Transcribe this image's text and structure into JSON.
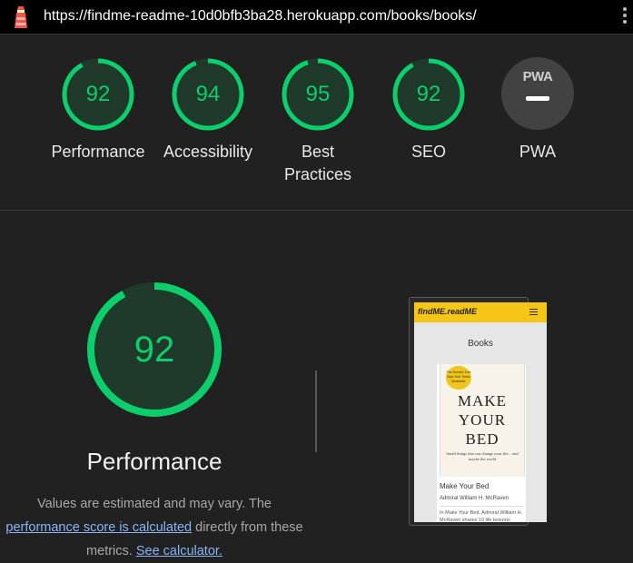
{
  "topbar": {
    "logo_icon": "lighthouse-icon",
    "url": "https://findme-readme-10d0bfb3ba28.herokuapp.com/books/books/",
    "menu_icon": "kebab-menu-icon"
  },
  "colors": {
    "pass": "#0cce6b",
    "pwa_gray": "#424242",
    "background": "#212121"
  },
  "summary": {
    "categories": [
      {
        "label": "Performance",
        "score": "92",
        "value": 92
      },
      {
        "label": "Accessibility",
        "score": "94",
        "value": 94
      },
      {
        "label": "Best Practices",
        "score": "95",
        "value": 95
      },
      {
        "label": "SEO",
        "score": "92",
        "value": 92
      }
    ],
    "pwa": {
      "label": "PWA",
      "badge": "PWA"
    }
  },
  "performance": {
    "score": "92",
    "value": 92,
    "title": "Performance",
    "desc_prefix": "Values are estimated and may vary. The",
    "desc_link1": "performance score is calculated",
    "desc_mid": "directly from these",
    "desc_metrics": "metrics.",
    "desc_link2": "See calculator."
  },
  "screenshot": {
    "brand": "findME.readME",
    "heading": "Books",
    "book_title": "Make Your Bed",
    "author": "Admiral William H. McRaven",
    "desc_snippet": "In Make Your Bed, Admiral William H. McRaven shares 10 life lessons",
    "cover_title_line1": "MAKE",
    "cover_title_line2": "YOUR",
    "cover_title_line3": "BED",
    "cover_subtitle": "Small things that can change your life... and maybe the world",
    "cover_badge": "The Number One New York Times Bestseller"
  }
}
